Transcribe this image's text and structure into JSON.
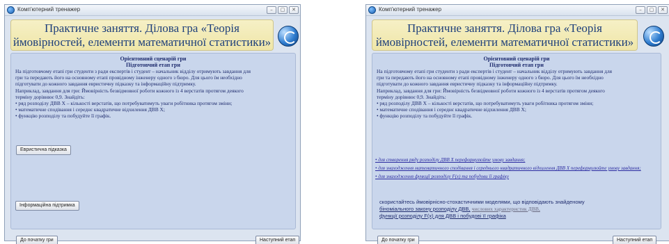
{
  "window_title": "Комп'ютерний тренажер",
  "window_buttons": [
    "–",
    "▢",
    "✕"
  ],
  "header_title": "Практичне заняття. Ділова гра «Теорія ймовірностей, елементи математичної статистики»",
  "scenario_title": "Орієнтовний сценарій гри",
  "stage_title": "Підготовчий етап гри",
  "intro_lines": [
    "На підготовчому етапі гри студенти з ради експертів і студент – начальник відділу отримують завдання для",
    "гри та передають його на основному етапі провідному інженеру одного з бюро. Для цього їм необхідно",
    "підготувати до кожного завдання евристичну підказку та інформаційну підтримку.",
    "Наприклад, завдання для гри: Ймовірність безвідмовної роботи кожного із 4 верстатів протягом деякого",
    "терміну дорівнює 0,9. Знайдіть:",
    "• ряд розподілу ДВВ Х – кількості верстатів, що потребуватимуть уваги робітника протягом зміни;",
    "• математичне сподівання і середнє квадратичне відхилення ДВВ Х;",
    "• функцію розподілу   та побудуйте її графік."
  ],
  "buttons": {
    "heuristic_hint": "Евристична підказка",
    "info_support": "Інформаційна підтримка",
    "to_start": "До початку гри",
    "next_stage": "Наступний етап"
  },
  "hints": [
    "• для створення ряду розподілу ДВВ Х переформулюйте умову завдання;",
    "• для знаходження математичного сподівання і середнього квадратичного відхилення ДВВ Х переформулюйте умову завдання;",
    "• для знаходження функції розподілу F(x) та побудови її графіку"
  ],
  "support": {
    "intro": "скористайтесь ймовірнісно-стохастичними моделями, що відповідають знайденому",
    "link1": "біноміального закону розподілу ДВВ,",
    "link2": "числових характеристик ДВВ,",
    "link3": "функції розподілу F(x) для ДВВ і побудові її графіка"
  }
}
